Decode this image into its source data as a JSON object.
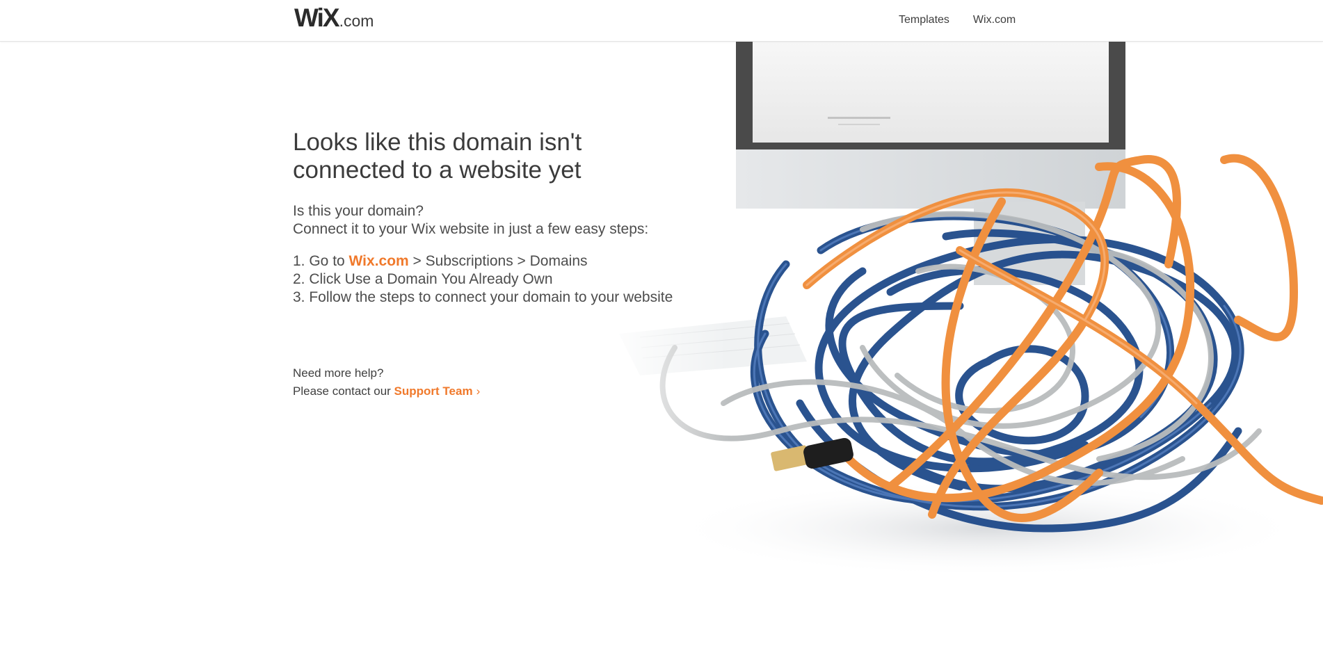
{
  "header": {
    "logo_mark": "WiX",
    "logo_suffix": ".com",
    "nav": [
      {
        "label": "Templates"
      },
      {
        "label": "Wix.com"
      }
    ]
  },
  "main": {
    "headline_line1": "Looks like this domain isn't",
    "headline_line2": "connected to a website yet",
    "lead_line1": "Is this your domain?",
    "lead_line2": "Connect it to your Wix website in just a few easy steps:",
    "step1_prefix": "1. Go to ",
    "step1_link": "Wix.com",
    "step1_suffix": " > Subscriptions > Domains",
    "step2": "2. Click Use a Domain You Already Own",
    "step3": "3. Follow the steps to connect your domain to your website",
    "help_line1": "Need more help?",
    "help_line2_prefix": "Please contact our ",
    "help_link": "Support Team",
    "help_chevron": "›"
  },
  "colors": {
    "accent": "#f0792b",
    "text": "#3b3b3b",
    "cable_blue": "#1f4a8a",
    "cable_orange": "#f0903f",
    "cable_silver": "#b9bcbd"
  },
  "icons": {
    "hero_image": "tangled-cables-illustration"
  }
}
